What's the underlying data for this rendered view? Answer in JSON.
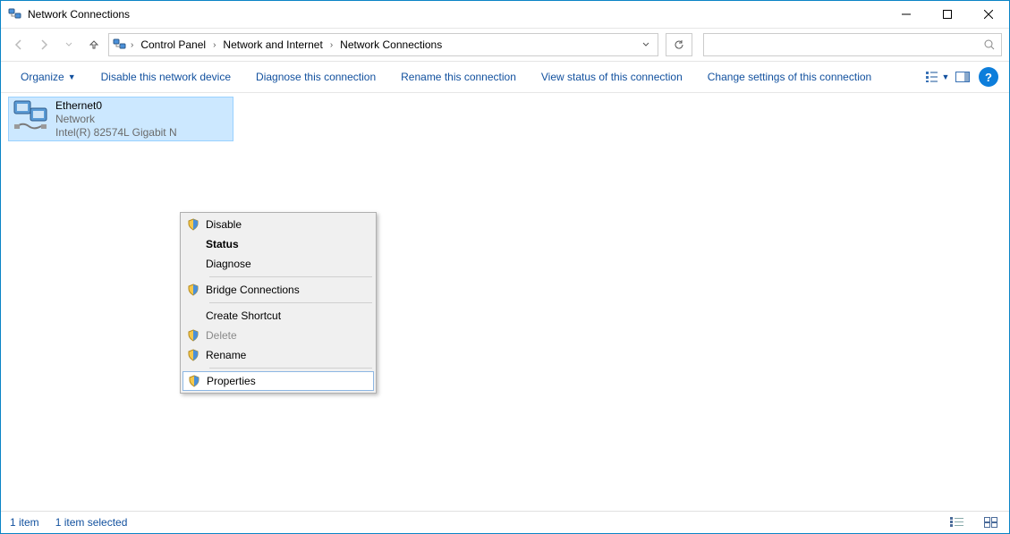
{
  "window": {
    "title": "Network Connections"
  },
  "breadcrumbs": {
    "0": "Control Panel",
    "1": "Network and Internet",
    "2": "Network Connections"
  },
  "search": {
    "placeholder": ""
  },
  "cmdbar": {
    "organize": "Organize",
    "disable": "Disable this network device",
    "diagnose": "Diagnose this connection",
    "rename": "Rename this connection",
    "viewstatus": "View status of this connection",
    "changesettings": "Change settings of this connection"
  },
  "adapter": {
    "name": "Ethernet0",
    "network": "Network",
    "device": "Intel(R) 82574L Gigabit N"
  },
  "ctx": {
    "disable": "Disable",
    "status": "Status",
    "diagnose": "Diagnose",
    "bridge": "Bridge Connections",
    "shortcut": "Create Shortcut",
    "delete": "Delete",
    "rename": "Rename",
    "properties": "Properties"
  },
  "status": {
    "count": "1 item",
    "selected": "1 item selected"
  }
}
